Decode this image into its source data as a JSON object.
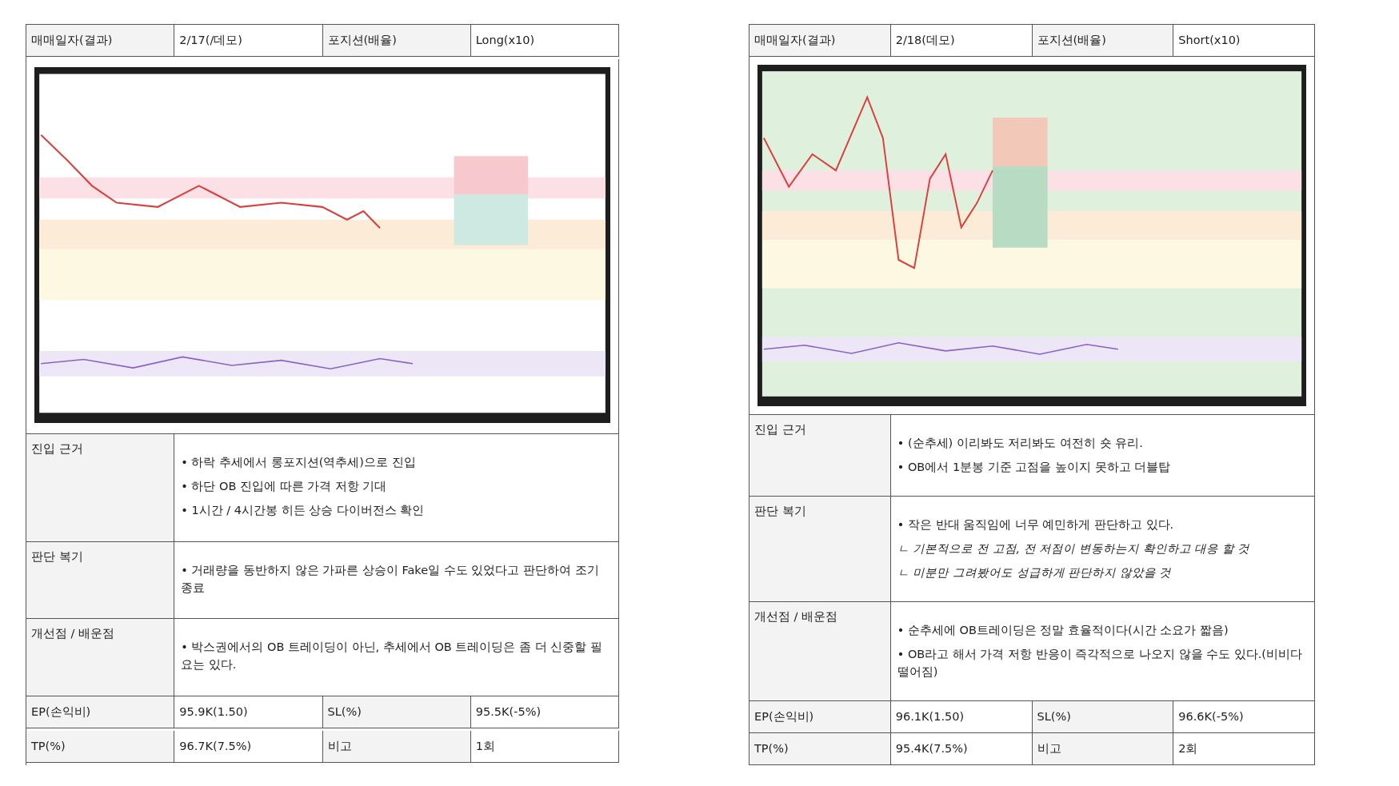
{
  "reports": [
    {
      "header": [
        {
          "label": "매매일자(결과)",
          "value": "2/17(/데모)"
        },
        {
          "label": "포지션(배율)",
          "value": "Long(x10)"
        }
      ],
      "chart": {
        "kind": "picture"
      },
      "sections": [
        {
          "label": "진입 근거",
          "lines": [
            {
              "kind": "bullet",
              "text": "• 하락 추세에서 롱포지션(역추세)으로 진입"
            },
            {
              "kind": "bullet",
              "text": "• 하단 OB 진입에 따른 가격 저항 기대"
            },
            {
              "kind": "bullet",
              "text": "• 1시간 / 4시간봉 히든 상승 다이버전스 확인"
            }
          ]
        },
        {
          "label": "판단 복기",
          "lines": [
            {
              "kind": "bullet",
              "text": "• 거래량을 동반하지 않은 가파른 상승이 Fake일 수도 있었다고 판단하여 조기 종료"
            }
          ]
        },
        {
          "label": "개선점 / 배운점",
          "lines": [
            {
              "kind": "bullet",
              "text": "• 박스권에서의 OB 트레이딩이 아닌, 추세에서 OB 트레이딩은 좀 더 신중할 필요는 있다."
            }
          ]
        }
      ],
      "footer": [
        [
          {
            "label": "EP(손익비)",
            "value": "95.9K(1.50)"
          },
          {
            "label": "SL(%)",
            "value": "95.5K(-5%)"
          }
        ],
        [
          {
            "label": "TP(%)",
            "value": "96.7K(7.5%)"
          },
          {
            "label": "비고",
            "value": "1회"
          }
        ]
      ]
    },
    {
      "header": [
        {
          "label": "매매일자(결과)",
          "value": "2/18(데모)"
        },
        {
          "label": "포지션(배율)",
          "value": "Short(x10)"
        }
      ],
      "chart": {
        "kind": "picture"
      },
      "sections": [
        {
          "label": "진입 근거",
          "lines": [
            {
              "kind": "bullet",
              "text": "• (순추세) 이리봐도 저리봐도 여전히 숏 유리."
            },
            {
              "kind": "bullet",
              "text": "• OB에서 1분봉 기준 고점을 높이지 못하고 더블탑"
            }
          ]
        },
        {
          "label": "판단 복기",
          "lines": [
            {
              "kind": "bullet",
              "text": "• 작은 반대 움직임에 너무 예민하게 판단하고 있다."
            },
            {
              "kind": "note",
              "text": "ㄴ 기본적으로 전 고점, 전 저점이 변동하는지 확인하고 대응 할 것"
            },
            {
              "kind": "note",
              "text": "ㄴ 미분만 그려봤어도 성급하게 판단하지 않았을 것"
            }
          ]
        },
        {
          "label": "개선점 / 배운점",
          "lines": [
            {
              "kind": "bullet",
              "text": "• 순추세에 OB트레이딩은 정말 효율적이다(시간 소요가 짧음)"
            },
            {
              "kind": "bullet",
              "text": "• OB라고 해서 가격 저항 반응이 즉각적으로 나오지 않을 수도 있다.(비비다 떨어짐)"
            }
          ]
        }
      ],
      "footer": [
        [
          {
            "label": "EP(손익비)",
            "value": "96.1K(1.50)"
          },
          {
            "label": "SL(%)",
            "value": "96.6K(-5%)"
          }
        ],
        [
          {
            "label": "TP(%)",
            "value": "95.4K(7.5%)"
          },
          {
            "label": "비고",
            "value": "2회"
          }
        ]
      ]
    }
  ]
}
